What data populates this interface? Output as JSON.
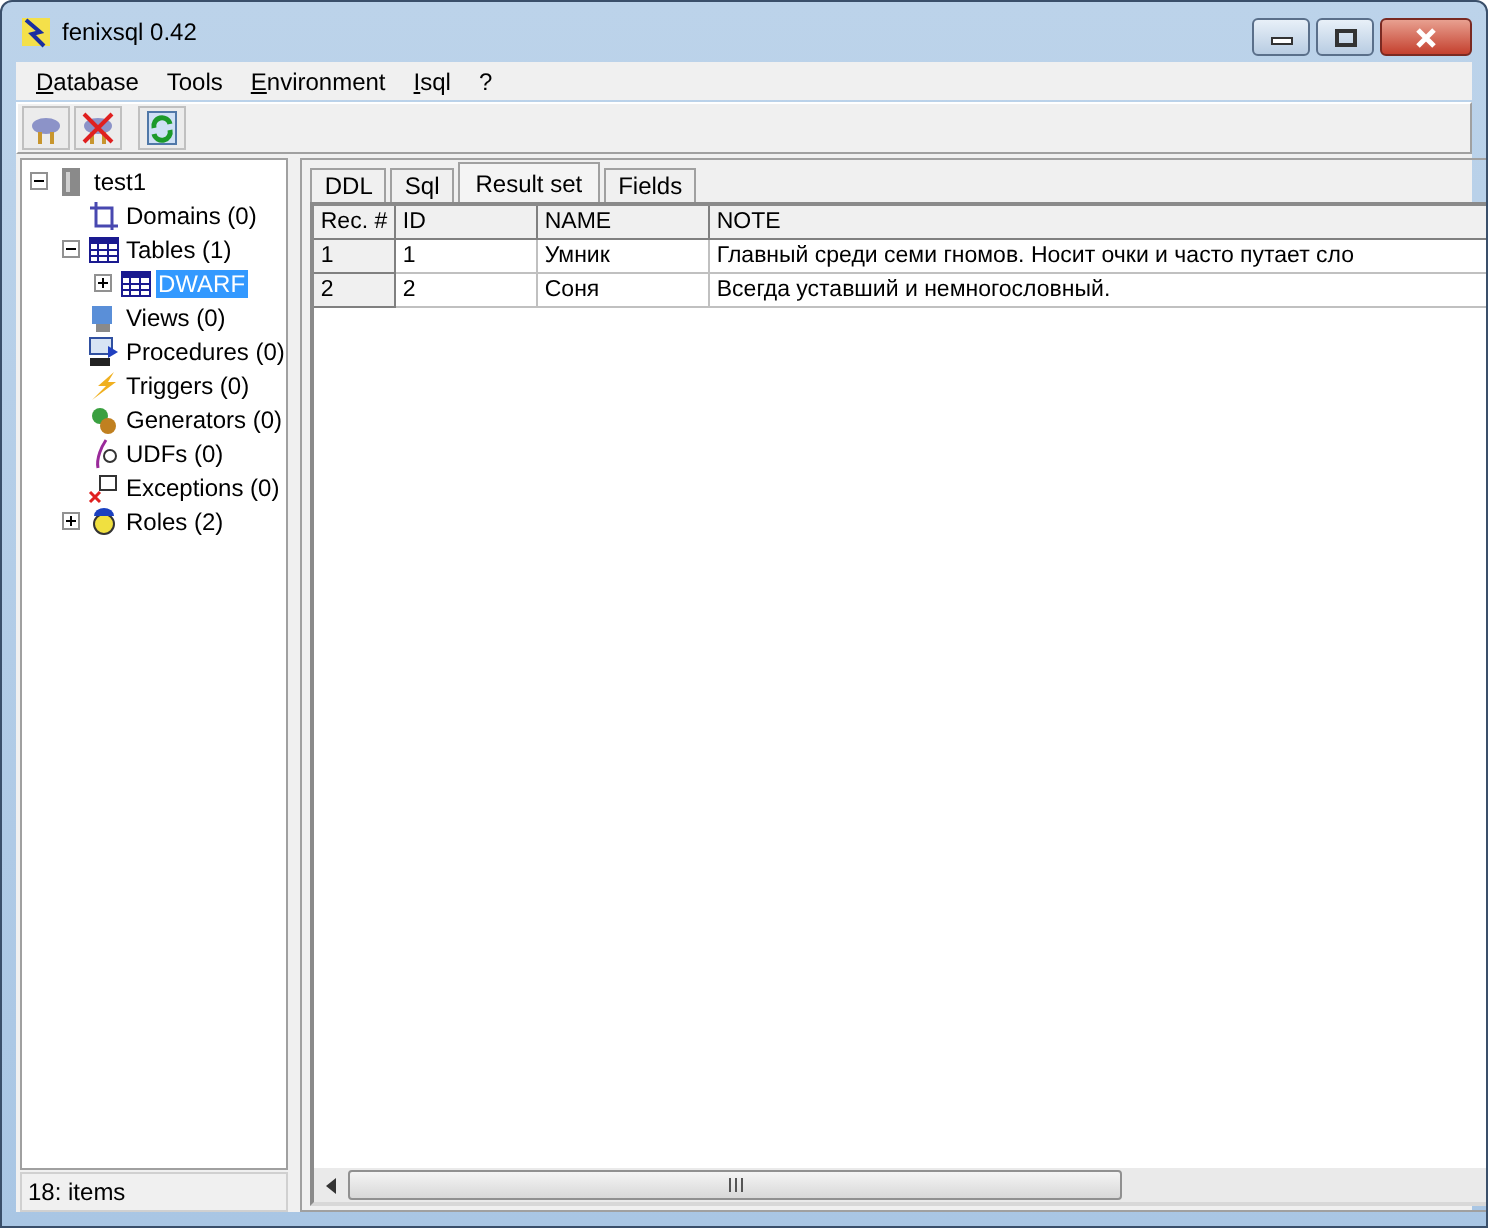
{
  "window": {
    "title": "fenixsql 0.42"
  },
  "menu": [
    {
      "label": "Database",
      "mnemonic": true
    },
    {
      "label": "Tools",
      "mnemonic": false
    },
    {
      "label": "Environment",
      "mnemonic": true
    },
    {
      "label": "Isql",
      "mnemonic": true
    },
    {
      "label": "?"
    }
  ],
  "toolbar": [
    {
      "kind": "connect"
    },
    {
      "kind": "disconnect"
    },
    {
      "kind": "refresh"
    }
  ],
  "tree": [
    {
      "label": "test1",
      "kind": "database",
      "expanded": true,
      "selected": false,
      "children": [
        {
          "label": "Domains (0)",
          "kind": "domain",
          "selected": false
        },
        {
          "label": "Tables (1)",
          "kind": "table",
          "expanded": true,
          "selected": false,
          "children": [
            {
              "label": "DWARF",
              "kind": "table",
              "expanded": false,
              "selected": true
            }
          ]
        },
        {
          "label": "Views (0)",
          "kind": "view",
          "selected": false
        },
        {
          "label": "Procedures (0)",
          "kind": "procedure",
          "selected": false
        },
        {
          "label": "Triggers (0)",
          "kind": "trigger",
          "selected": false
        },
        {
          "label": "Generators (0)",
          "kind": "generator",
          "selected": false
        },
        {
          "label": "UDFs (0)",
          "kind": "udf",
          "selected": false
        },
        {
          "label": "Exceptions (0)",
          "kind": "exception",
          "selected": false
        },
        {
          "label": "Roles (2)",
          "kind": "role",
          "expanded": false,
          "selected": false
        }
      ]
    }
  ],
  "status_bar": "18: items",
  "tabs": [
    {
      "label": "DDL",
      "selected": false
    },
    {
      "label": "Sql",
      "selected": false
    },
    {
      "label": "Result set",
      "selected": true
    },
    {
      "label": "Fields",
      "selected": false
    }
  ],
  "table": {
    "columns": [
      "Rec. #",
      "ID",
      "NAME",
      "NOTE"
    ],
    "rows": [
      [
        "1",
        "1",
        "Умник",
        "Главный среди семи гномов. Носит очки и часто путает сло"
      ],
      [
        "2",
        "2",
        "Соня",
        "Всегда уставший и немногословный."
      ]
    ]
  }
}
